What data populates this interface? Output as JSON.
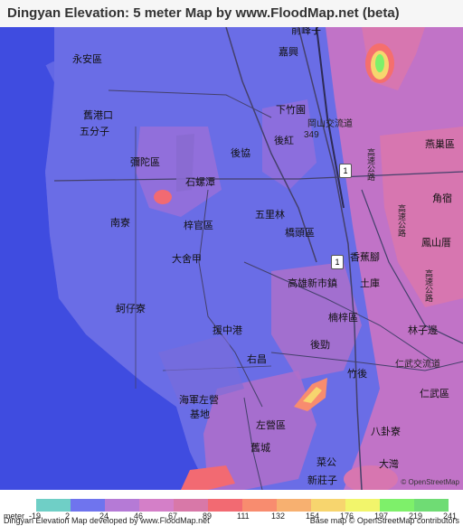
{
  "title": "Dingyan Elevation: 5 meter Map by www.FloodMap.net (beta)",
  "place_labels": {
    "yonganqu": "永安區",
    "jiugangkou": "舊港口",
    "wufenzi": "五分子",
    "mituoqu": "彌陀區",
    "shiluotan": "石螺潭",
    "nanliao": "南寮",
    "ziguanqu": "梓官區",
    "dashejia": "大舍甲",
    "kezailiao": "蚵仔寮",
    "jiaxing": "嘉興",
    "xiazhuyuan": "下竹園",
    "houxie": "後協",
    "houhong": "後紅",
    "yanchaoqu": "燕巢區",
    "jiaosu": "角宿",
    "wulilin": "五里林",
    "qiaotouqu": "橋頭區",
    "fengshancuo": "鳳山厝",
    "xiangjiaojiao": "香蕉腳",
    "gaoxiongxinshizhen": "高雄新市鎮",
    "tuku": "土庫",
    "nanziqu": "楠梓區",
    "yuanzhonggang": "援中港",
    "houjin": "後勁",
    "linzibian": "林子邊",
    "youchang": "右昌",
    "zhuhou": "竹後",
    "renwuqu": "仁武區",
    "haijunzuoying": "海軍左營",
    "jidi": "基地",
    "zuoyingqu": "左營區",
    "bagualiao": "八卦寮",
    "jiucheng": "舊城",
    "caigong": "菜公",
    "dawan": "大灣",
    "xinzhuangzi": "新莊子",
    "qianshan": "前峰子"
  },
  "road_labels": {
    "gangshan_interchange": "岡山交流道",
    "route349": "349",
    "freeway_a": "高速公路",
    "freeway_b": "高速公路",
    "freeway_c": "高速公路",
    "renwu_interchange": "仁武交流道"
  },
  "shields": {
    "a": "1",
    "b": "1"
  },
  "attribution_map": "© OpenStreetMap",
  "legend": {
    "prefix": "meter",
    "ticks": [
      "-19",
      "2",
      "24",
      "46",
      "67",
      "89",
      "111",
      "132",
      "154",
      "176",
      "197",
      "219",
      "241"
    ],
    "colors": [
      "#6fcfc6",
      "#6f74ee",
      "#b57ad6",
      "#d47fc8",
      "#d878a8",
      "#f26a72",
      "#f88c6f",
      "#f7b070",
      "#f7d56e",
      "#f2f56b",
      "#7ef06a",
      "#6fdc74"
    ]
  },
  "footer": {
    "left": "Dingyan Elevation Map developed by www.FloodMap.net",
    "right": "Base map © OpenStreetMap contributors"
  }
}
